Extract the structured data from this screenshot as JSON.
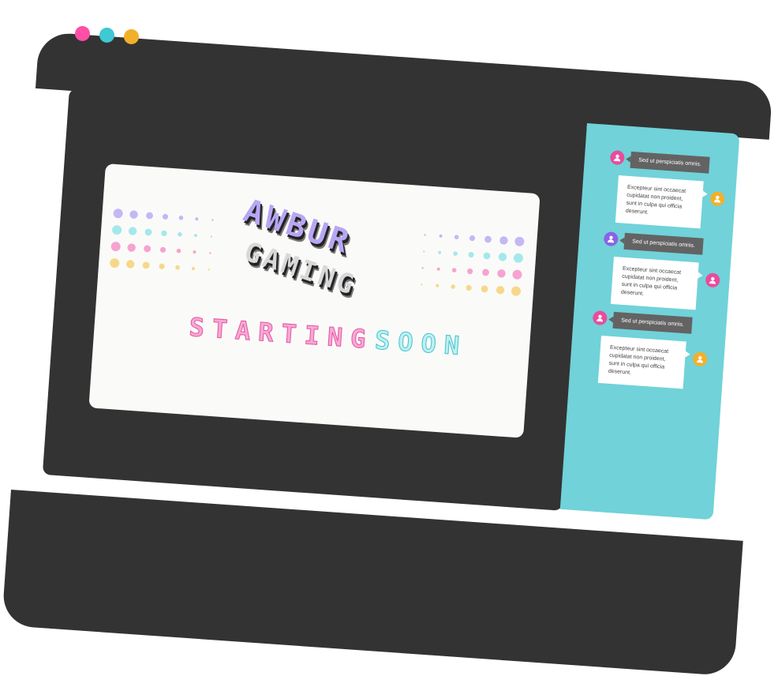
{
  "window": {
    "controls": [
      {
        "name": "close",
        "color": "#ff4fa6"
      },
      {
        "name": "minimize",
        "color": "#3ec9d3"
      },
      {
        "name": "maximize",
        "color": "#f2b02a"
      }
    ]
  },
  "stream": {
    "logo_line1": "AWBUR",
    "logo_line2": "GAMING",
    "starting_text": "STARTING",
    "soon_text": "SOON",
    "palette": {
      "purple": "#b8a6f5",
      "cyan": "#8ee3e8",
      "pink": "#f58dc7",
      "yellow": "#f5cf6e"
    }
  },
  "chat": {
    "messages": [
      {
        "sender": "left",
        "avatar_color": "#e94c9e",
        "text": "Sed ut perspiciatis omnis."
      },
      {
        "sender": "right",
        "avatar_color": "#f2b02a",
        "text": "Excepteur sint occaecat cupidatat non proident, sunt in culpa qui officia deserunt."
      },
      {
        "sender": "left",
        "avatar_color": "#8a63e6",
        "text": "Sed ut perspiciatis omnis."
      },
      {
        "sender": "right",
        "avatar_color": "#e94c9e",
        "text": "Excepteur sint occaecat cupidatat non proident, sunt in culpa qui officia deserunt."
      },
      {
        "sender": "left",
        "avatar_color": "#e94c9e",
        "text": "Sed ut perspiciatis omnis."
      },
      {
        "sender": "right",
        "avatar_color": "#f2b02a",
        "text": "Excepteur sint occaecat cupidatat non proident, sunt in culpa qui officia deserunt."
      }
    ]
  }
}
